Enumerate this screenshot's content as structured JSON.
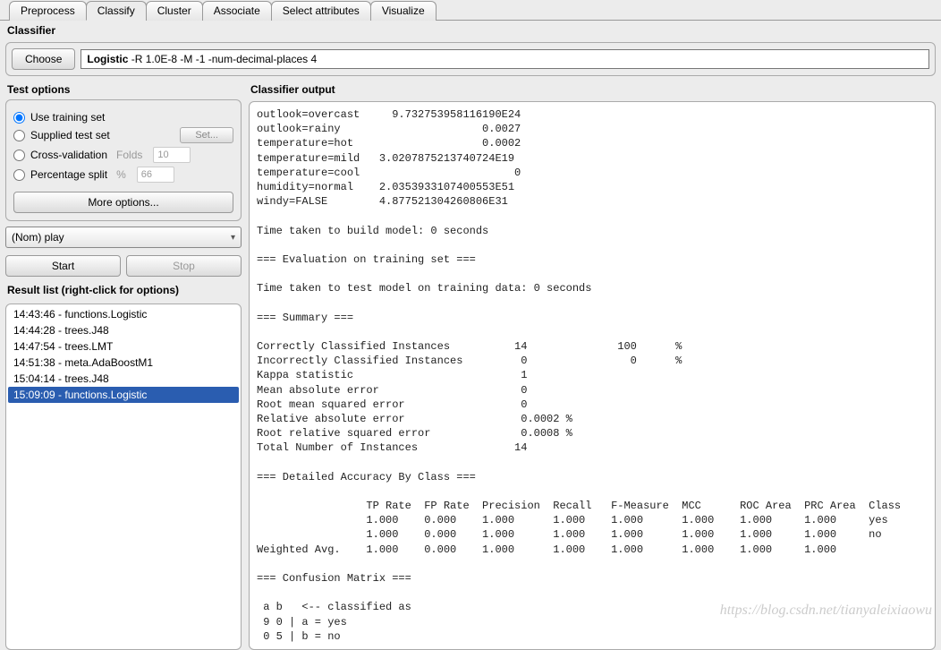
{
  "tabs": [
    "Preprocess",
    "Classify",
    "Cluster",
    "Associate",
    "Select attributes",
    "Visualize"
  ],
  "activeTab": 1,
  "classifier": {
    "panel": "Classifier",
    "chooseLabel": "Choose",
    "name": "Logistic",
    "args": "-R 1.0E-8 -M -1 -num-decimal-places 4"
  },
  "testOptions": {
    "title": "Test options",
    "r1": "Use training set",
    "r2": "Supplied test set",
    "setBtn": "Set...",
    "r3": "Cross-validation",
    "foldsLabel": "Folds",
    "foldsVal": "10",
    "r4": "Percentage split",
    "pctLabel": "%",
    "pctVal": "66",
    "more": "More options...",
    "combo": "(Nom) play",
    "start": "Start",
    "stop": "Stop"
  },
  "resultList": {
    "title": "Result list (right-click for options)",
    "items": [
      "14:43:46 - functions.Logistic",
      "14:44:28 - trees.J48",
      "14:47:54 - trees.LMT",
      "14:51:38 - meta.AdaBoostM1",
      "15:04:14 - trees.J48",
      "15:09:09 - functions.Logistic"
    ],
    "selected": 5
  },
  "output": {
    "title": "Classifier output",
    "text": "outlook=overcast     9.732753958116190E24\noutlook=rainy                      0.0027\ntemperature=hot                    0.0002\ntemperature=mild   3.0207875213740724E19\ntemperature=cool                        0\nhumidity=normal    2.0353933107400553E51\nwindy=FALSE        4.877521304260806E31\n\nTime taken to build model: 0 seconds\n\n=== Evaluation on training set ===\n\nTime taken to test model on training data: 0 seconds\n\n=== Summary ===\n\nCorrectly Classified Instances          14              100      %\nIncorrectly Classified Instances         0                0      %\nKappa statistic                          1     \nMean absolute error                      0     \nRoot mean squared error                  0     \nRelative absolute error                  0.0002 %\nRoot relative squared error              0.0008 %\nTotal Number of Instances               14     \n\n=== Detailed Accuracy By Class ===\n\n                 TP Rate  FP Rate  Precision  Recall   F-Measure  MCC      ROC Area  PRC Area  Class\n                 1.000    0.000    1.000      1.000    1.000      1.000    1.000     1.000     yes\n                 1.000    0.000    1.000      1.000    1.000      1.000    1.000     1.000     no\nWeighted Avg.    1.000    0.000    1.000      1.000    1.000      1.000    1.000     1.000     \n\n=== Confusion Matrix ===\n\n a b   <-- classified as\n 9 0 | a = yes\n 0 5 | b = no"
  },
  "watermark": "https://blog.csdn.net/tianyaleixiaowu"
}
